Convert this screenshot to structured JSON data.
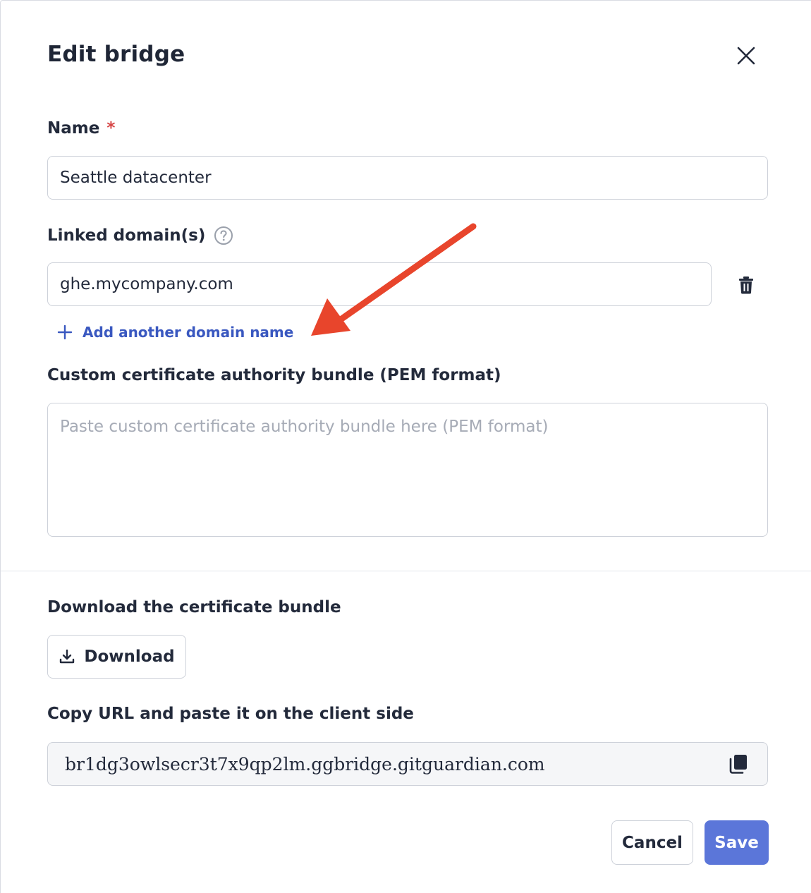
{
  "dialog": {
    "title": "Edit bridge"
  },
  "name_field": {
    "label": "Name",
    "required_mark": "*",
    "value": "Seattle datacenter"
  },
  "domains_field": {
    "label": "Linked domain(s)",
    "value": "ghe.mycompany.com",
    "add_label": "Add another domain name"
  },
  "ca_bundle": {
    "label": "Custom certificate authority bundle (PEM format)",
    "placeholder": "Paste custom certificate authority bundle here (PEM format)"
  },
  "download_section": {
    "label": "Download the certificate bundle",
    "button_label": "Download"
  },
  "url_section": {
    "label": "Copy URL and paste it on the client side",
    "url": "br1dg3owlsecr3t7x9qp2lm.ggbridge.gitguardian.com"
  },
  "footer": {
    "cancel_label": "Cancel",
    "save_label": "Save"
  },
  "colors": {
    "primary": "#5b76d9",
    "link": "#3a58c0",
    "required": "#d64545",
    "annotation_arrow": "#e8452c"
  },
  "icons": {
    "close": "close-icon",
    "help": "question-circle-icon",
    "delete": "trash-icon",
    "add": "plus-icon",
    "download": "download-icon",
    "copy": "copy-icon"
  }
}
